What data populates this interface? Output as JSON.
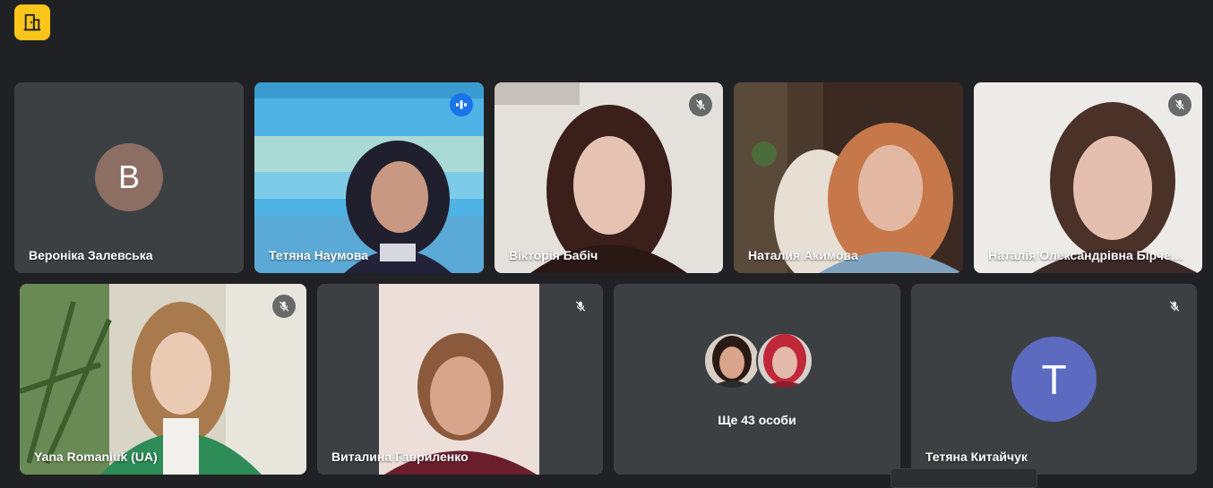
{
  "app": {
    "brand_icon": "door-exit-icon",
    "accent": "#f9c51b"
  },
  "participants": [
    {
      "name": "Вероніка Залевська",
      "initial": "В",
      "avatar_color": "#8d6e63",
      "muted": false
    },
    {
      "name": "Тетяна Наумова",
      "speaking": true
    },
    {
      "name": "Вікторія Бабіч",
      "muted": true
    },
    {
      "name": "Наталия Акимова",
      "muted": false
    },
    {
      "name": "Наталія Олександрівна Бірчен…",
      "muted": true
    },
    {
      "name": "Yana Romaniuk (UA)",
      "muted": true
    },
    {
      "name": "Виталина Гавриленко",
      "muted": true
    },
    {
      "name": "Тетяна Китайчук",
      "initial": "T",
      "avatar_color": "#5c6bc0",
      "muted": true
    }
  ],
  "others": {
    "label": "Ще 43 особи"
  },
  "colors": {
    "speaking": "#1a73e8",
    "active_border": "#8ab4f8",
    "tile_bg": "#3c4043",
    "page_bg": "#202124"
  }
}
